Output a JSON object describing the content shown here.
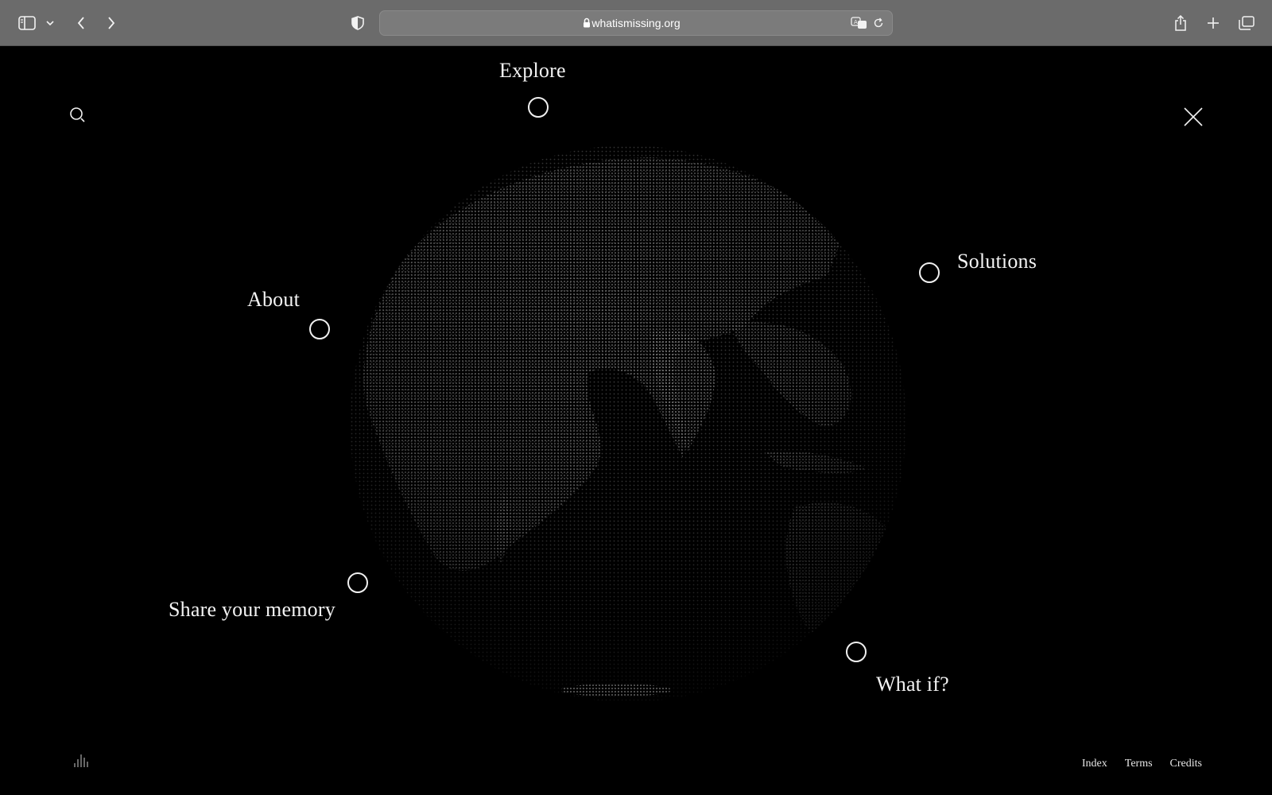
{
  "browser": {
    "url": "whatismissing.org"
  },
  "nav": {
    "explore": "Explore",
    "solutions": "Solutions",
    "about": "About",
    "share": "Share your memory",
    "whatif": "What if?"
  },
  "footer": {
    "index": "Index",
    "terms": "Terms",
    "credits": "Credits"
  },
  "icons": {
    "sidebar": "sidebar-icon",
    "back": "chevron-left-icon",
    "forward": "chevron-right-icon",
    "privacy": "shield-icon",
    "lock": "lock-icon",
    "translate": "translate-icon",
    "reload": "reload-icon",
    "share": "share-icon",
    "new_tab": "plus-icon",
    "tabs": "tabs-overview-icon",
    "search": "search-icon",
    "close": "close-icon",
    "audio": "audio-bars-icon"
  },
  "colors": {
    "background": "#000000",
    "chrome": "#6b6b6b",
    "text": "#ffffff"
  }
}
